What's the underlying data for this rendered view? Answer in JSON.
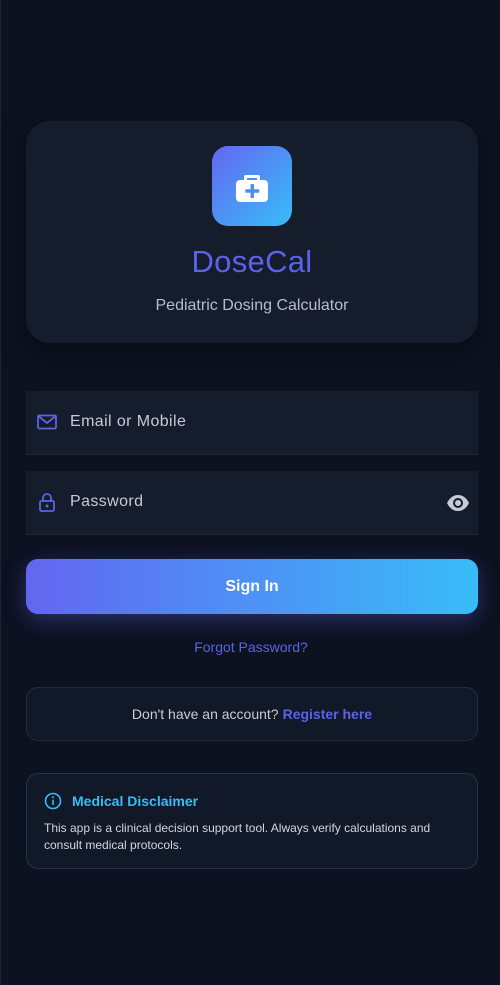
{
  "brand": {
    "name": "DoseCal",
    "tagline": "Pediatric Dosing Calculator",
    "icon": "medical-kit-icon"
  },
  "login": {
    "email_label": "Email or Mobile",
    "password_label": "Password",
    "email_icon": "mail-icon",
    "password_icon": "lock-icon",
    "visibility_icon": "eye-icon",
    "signin_label": "Sign In",
    "forgot_label": "Forgot Password?"
  },
  "register": {
    "prompt": "Don't have an account?",
    "link": "Register here"
  },
  "disclaimer": {
    "title": "Medical Disclaimer",
    "text": "This app is a clinical decision support tool. Always verify calculations and consult medical protocols.",
    "icon": "info-icon"
  },
  "colors": {
    "background": "#0c1220",
    "card": "#151c2c",
    "accent_indigo": "#6366f1",
    "accent_sky": "#38bdf8"
  }
}
